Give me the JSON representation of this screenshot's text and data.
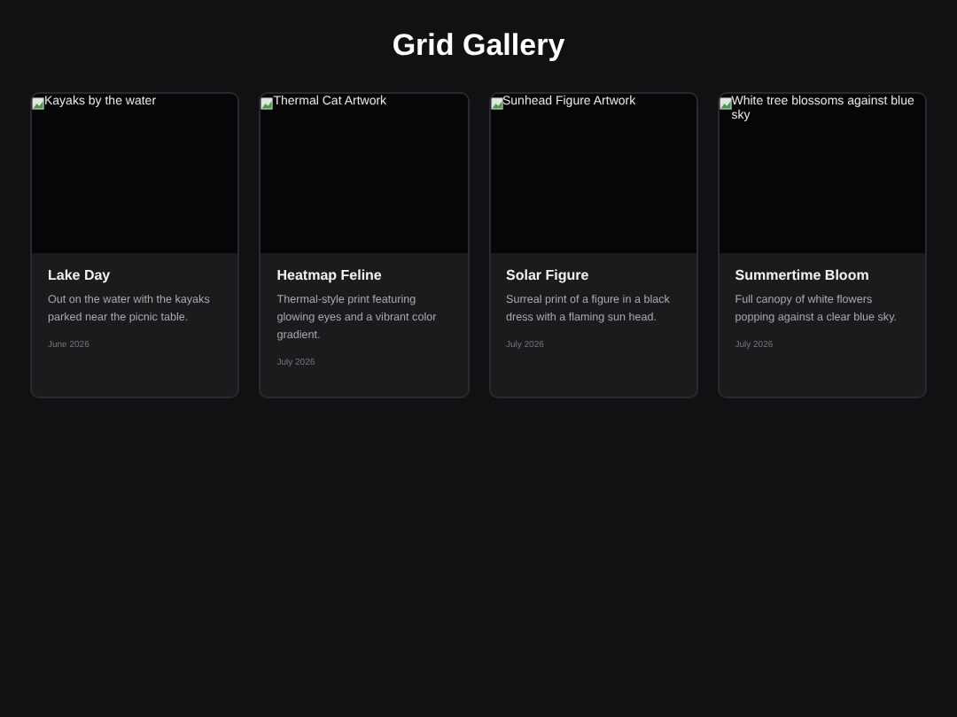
{
  "title": "Grid Gallery",
  "cards": [
    {
      "alt": "Kayaks by the water",
      "title": "Lake Day",
      "description": "Out on the water with the kayaks parked near the picnic table.",
      "date": "June 2026"
    },
    {
      "alt": "Thermal Cat Artwork",
      "title": "Heatmap Feline",
      "description": "Thermal-style print featuring glowing eyes and a vibrant color gradient.",
      "date": "July 2026"
    },
    {
      "alt": "Sunhead Figure Artwork",
      "title": "Solar Figure",
      "description": "Surreal print of a figure in a black dress with a flaming sun head.",
      "date": "July 2026"
    },
    {
      "alt": "White tree blossoms against blue sky",
      "title": "Summertime Bloom",
      "description": "Full canopy of white flowers popping against a clear blue sky.",
      "date": "July 2026"
    }
  ]
}
